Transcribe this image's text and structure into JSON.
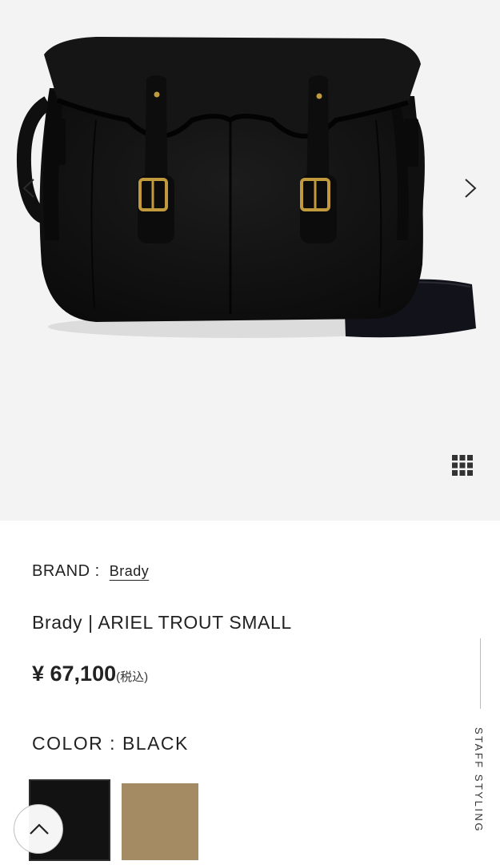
{
  "product": {
    "brand_label": "BRAND :",
    "brand_name": "Brady",
    "title": "Brady | ARIEL TROUT SMALL",
    "price": "¥ 67,100",
    "tax_note": "(税込)",
    "color_label": "COLOR : BLACK"
  },
  "swatches": [
    {
      "name": "BLACK",
      "color": "#121212"
    },
    {
      "name": "KHAKI",
      "color": "#a58b64"
    }
  ],
  "side_panel": {
    "label": "STAFF STYLING"
  },
  "icons": {
    "prev": "chevron-left-icon",
    "next": "chevron-right-icon",
    "grid": "grid-icon",
    "scroll_top": "chevron-up-icon"
  },
  "colors": {
    "gallery_bg": "#f3f3f3",
    "bag": "#141414",
    "buckle": "#c19a3e"
  }
}
